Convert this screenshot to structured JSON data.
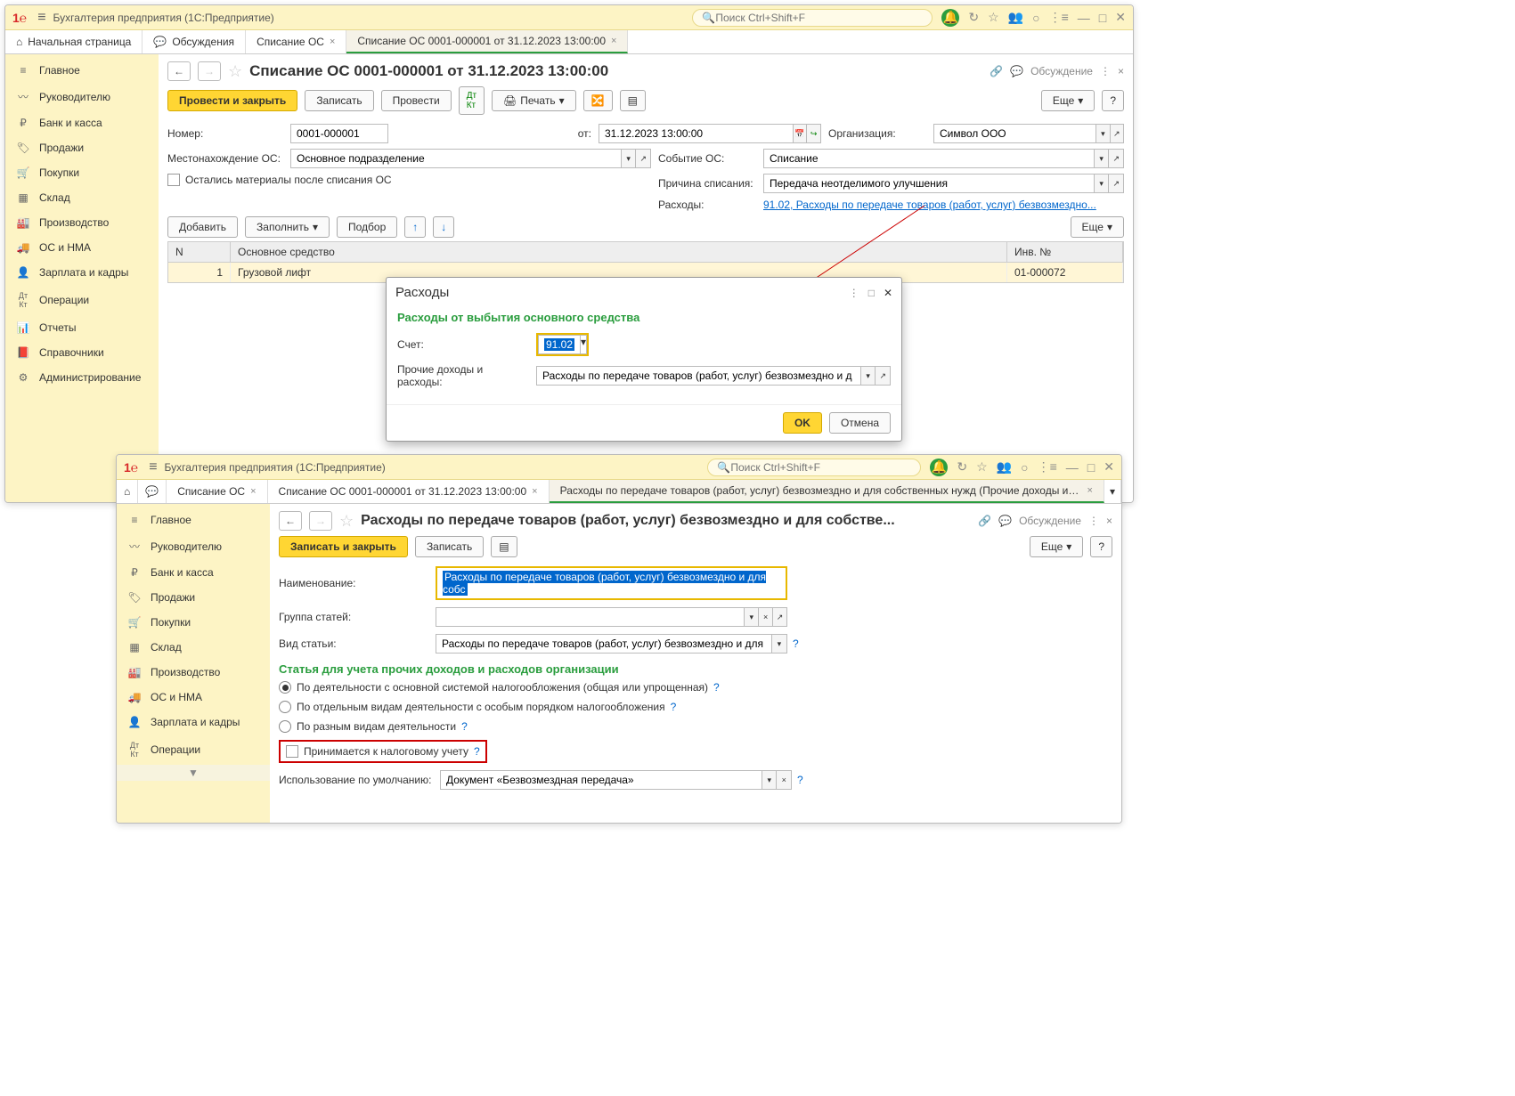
{
  "win1": {
    "app_title": "Бухгалтерия предприятия  (1С:Предприятие)",
    "search_placeholder": "Поиск Ctrl+Shift+F",
    "tabs": {
      "home": "Начальная страница",
      "discuss": "Обсуждения",
      "t1": "Списание ОС",
      "t2": "Списание ОС 0001-000001 от 31.12.2023 13:00:00"
    },
    "sidebar": [
      "Главное",
      "Руководителю",
      "Банк и касса",
      "Продажи",
      "Покупки",
      "Склад",
      "Производство",
      "ОС и НМА",
      "Зарплата и кадры",
      "Операции",
      "Отчеты",
      "Справочники",
      "Администрирование"
    ],
    "doc_title": "Списание ОС 0001-000001 от 31.12.2023 13:00:00",
    "discussion_label": "Обсуждение",
    "buttons": {
      "post_close": "Провести и закрыть",
      "write": "Записать",
      "post": "Провести",
      "print": "Печать",
      "more": "Еще",
      "add": "Добавить",
      "fill": "Заполнить",
      "select": "Подбор"
    },
    "labels": {
      "number": "Номер:",
      "from": "от:",
      "location": "Местонахождение ОС:",
      "remain": "Остались материалы после списания ОС",
      "org": "Организация:",
      "event": "Событие ОС:",
      "reason": "Причина списания:",
      "expenses": "Расходы:"
    },
    "fields": {
      "number": "0001-000001",
      "date": "31.12.2023 13:00:00",
      "location": "Основное подразделение",
      "org": "Символ ООО",
      "event": "Списание",
      "reason": "Передача неотделимого улучшения",
      "expenses_link": "91.02, Расходы по передаче товаров (работ, услуг) безвозмездно..."
    },
    "table": {
      "headers": {
        "n": "N",
        "asset": "Основное средство",
        "inv": "Инв. №"
      },
      "row": {
        "n": "1",
        "asset": "Грузовой лифт",
        "inv": "01-000072"
      }
    },
    "modal": {
      "title": "Расходы",
      "subtitle": "Расходы от выбытия основного средства",
      "account_label": "Счет:",
      "account_value": "91.02",
      "other_label": "Прочие доходы и расходы:",
      "other_value": "Расходы по передаче товаров (работ, услуг) безвозмездно и д",
      "ok": "OK",
      "cancel": "Отмена"
    }
  },
  "win2": {
    "app_title": "Бухгалтерия предприятия  (1С:Предприятие)",
    "search_placeholder": "Поиск Ctrl+Shift+F",
    "tabs": {
      "t1": "Списание ОС",
      "t2": "Списание ОС 0001-000001 от 31.12.2023 13:00:00",
      "t3": "Расходы по передаче товаров (работ, услуг) безвозмездно и для собственных нужд (Прочие доходы и р..."
    },
    "sidebar": [
      "Главное",
      "Руководителю",
      "Банк и касса",
      "Продажи",
      "Покупки",
      "Склад",
      "Производство",
      "ОС и НМА",
      "Зарплата и кадры",
      "Операции"
    ],
    "doc_title": "Расходы по передаче товаров (работ, услуг) безвозмездно и для собстве...",
    "discussion_label": "Обсуждение",
    "buttons": {
      "write_close": "Записать и закрыть",
      "write": "Записать",
      "more": "Еще"
    },
    "labels": {
      "name": "Наименование:",
      "group": "Группа статей:",
      "type": "Вид статьи:",
      "section": "Статья для учета прочих доходов и расходов организации",
      "r1": "По деятельности с основной системой налогообложения (общая или упрощенная)",
      "r2": "По отдельным видам деятельности с особым порядком налогообложения",
      "r3": "По разным видам деятельности",
      "tax": "Принимается к налоговому учету",
      "default": "Использование по умолчанию:"
    },
    "fields": {
      "name": "Расходы по передаче товаров (работ, услуг) безвозмездно и для собс",
      "type": "Расходы по передаче товаров (работ, услуг) безвозмездно и для с",
      "default": "Документ «Безвозмездная передача»"
    }
  }
}
